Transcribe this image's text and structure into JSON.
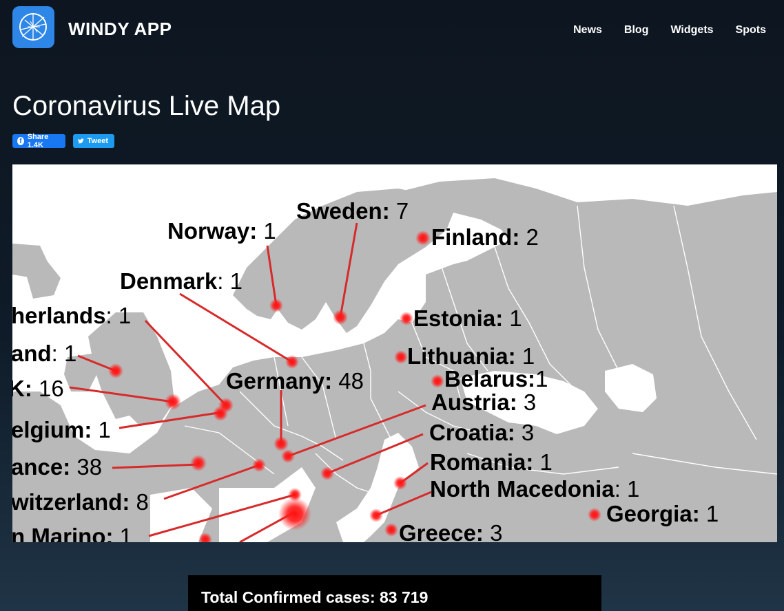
{
  "header": {
    "brand": "WINDY APP",
    "nav": [
      "News",
      "Blog",
      "Widgets",
      "Spots"
    ]
  },
  "page": {
    "title": "Coronavirus Live Map"
  },
  "share": {
    "facebook_label": "Share 1.4K",
    "twitter_label": "Tweet"
  },
  "map": {
    "labels": [
      {
        "id": "sweden",
        "country": "Sweden:",
        "count": "7"
      },
      {
        "id": "norway",
        "country": "Norway:",
        "count": "1"
      },
      {
        "id": "finland",
        "country": "Finland:",
        "count": "2"
      },
      {
        "id": "denmark",
        "country": "Denmark",
        "count": ": 1"
      },
      {
        "id": "netherlands",
        "country": "herlands",
        "count": ": 1"
      },
      {
        "id": "estonia",
        "country": "Estonia:",
        "count": "1"
      },
      {
        "id": "ireland",
        "country": "and",
        "count": ": 1"
      },
      {
        "id": "lithuania",
        "country": "Lithuania:",
        "count": "1"
      },
      {
        "id": "germany",
        "country": "Germany:",
        "count": "48"
      },
      {
        "id": "belarus",
        "country": "Belarus:",
        "count": "1"
      },
      {
        "id": "uk",
        "country": "K:",
        "count": "16"
      },
      {
        "id": "austria",
        "country": "Austria:",
        "count": "3"
      },
      {
        "id": "belgium",
        "country": "elgium:",
        "count": "1"
      },
      {
        "id": "croatia",
        "country": "Croatia:",
        "count": "3"
      },
      {
        "id": "france",
        "country": "ance:",
        "count": "38"
      },
      {
        "id": "romania",
        "country": "Romania:",
        "count": "1"
      },
      {
        "id": "switzerland",
        "country": "witzerland:",
        "count": "8"
      },
      {
        "id": "north_macedonia",
        "country": "North Macedonia",
        "count": ": 1"
      },
      {
        "id": "georgia",
        "country": "Georgia:",
        "count": "1"
      },
      {
        "id": "san_marino",
        "country": "n Marino:",
        "count": "1"
      },
      {
        "id": "greece",
        "country": "Greece:",
        "count": "3"
      }
    ]
  },
  "totals": {
    "label": "Total Confirmed cases: 83 719"
  },
  "colors": {
    "brand_blue": "#2e86e6",
    "marker_red": "#ff1010",
    "leader_red": "#d72a2a",
    "land_gray": "#b9b9b9"
  }
}
